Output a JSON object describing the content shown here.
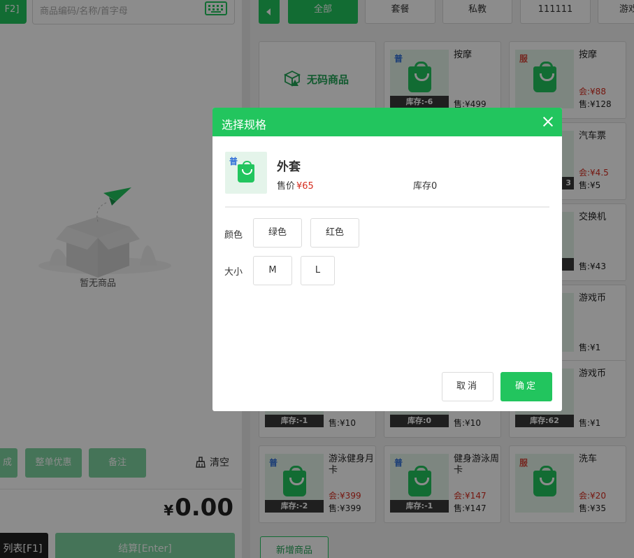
{
  "left": {
    "f2_label": "F2]",
    "search_placeholder": "商品编码/名称/首字母",
    "empty_text": "暂无商品",
    "actions": [
      "成",
      "整单优惠",
      "备注"
    ],
    "clear_label": "清空",
    "total_currency": "¥",
    "total_value": "0.00",
    "list_button": "列表[F1]",
    "pay_button": "结算[Enter]"
  },
  "tabs": [
    "全部",
    "套餐",
    "私教",
    "111111",
    "游戏"
  ],
  "active_tab": "全部",
  "nocode_label": "无码商品",
  "cards": [
    {
      "tag": "普",
      "tag_color": "blue",
      "name": "按摩",
      "stock": "库存:-6",
      "member": "",
      "sale": "售:¥499"
    },
    {
      "tag": "服",
      "tag_color": "red",
      "name": "按摩",
      "stock": "",
      "member": "会:¥88",
      "sale": "售:¥128"
    },
    {
      "tag": "",
      "tag_color": "blue",
      "name": "汽车票",
      "stock": "3",
      "member": "会:¥4.5",
      "sale": "售:¥5"
    },
    {
      "tag": "",
      "tag_color": "blue",
      "name": "交换机",
      "stock": "",
      "member": "",
      "sale": "售:¥43"
    },
    {
      "tag": "",
      "tag_color": "blue",
      "name": "游戏币",
      "stock": "",
      "member": "",
      "sale": "售:¥1"
    },
    {
      "tag": "",
      "tag_color": "blue",
      "name": "",
      "stock": "库存:-1",
      "member": "",
      "sale": "售:¥10"
    },
    {
      "tag": "",
      "tag_color": "blue",
      "name": "",
      "stock": "库存:0",
      "member": "",
      "sale": "售:¥10"
    },
    {
      "tag": "",
      "tag_color": "blue",
      "name": "游戏币",
      "stock": "库存:62",
      "member": "",
      "sale": "售:¥1"
    },
    {
      "tag": "普",
      "tag_color": "blue",
      "name": "游泳健身月卡",
      "stock": "库存:-2",
      "member": "会:¥399",
      "sale": "售:¥399"
    },
    {
      "tag": "普",
      "tag_color": "blue",
      "name": "健身游泳周卡",
      "stock": "库存:-1",
      "member": "会:¥147",
      "sale": "售:¥147"
    },
    {
      "tag": "服",
      "tag_color": "red",
      "name": "洗车",
      "stock": "",
      "member": "会:¥20",
      "sale": "售:¥35"
    }
  ],
  "add_button": "新增商品",
  "modal": {
    "title": "选择规格",
    "product_tag": "普",
    "product_name": "外套",
    "price_label": "售价",
    "price_value": "¥65",
    "stock_label": "库存0",
    "specs": [
      {
        "label": "颜色",
        "options": [
          "绿色",
          "红色"
        ]
      },
      {
        "label": "大小",
        "options": [
          "M",
          "L"
        ]
      }
    ],
    "cancel": "取消",
    "confirm": "确定"
  },
  "colors": {
    "accent": "#22c55e",
    "price_red": "#d52b1e"
  }
}
